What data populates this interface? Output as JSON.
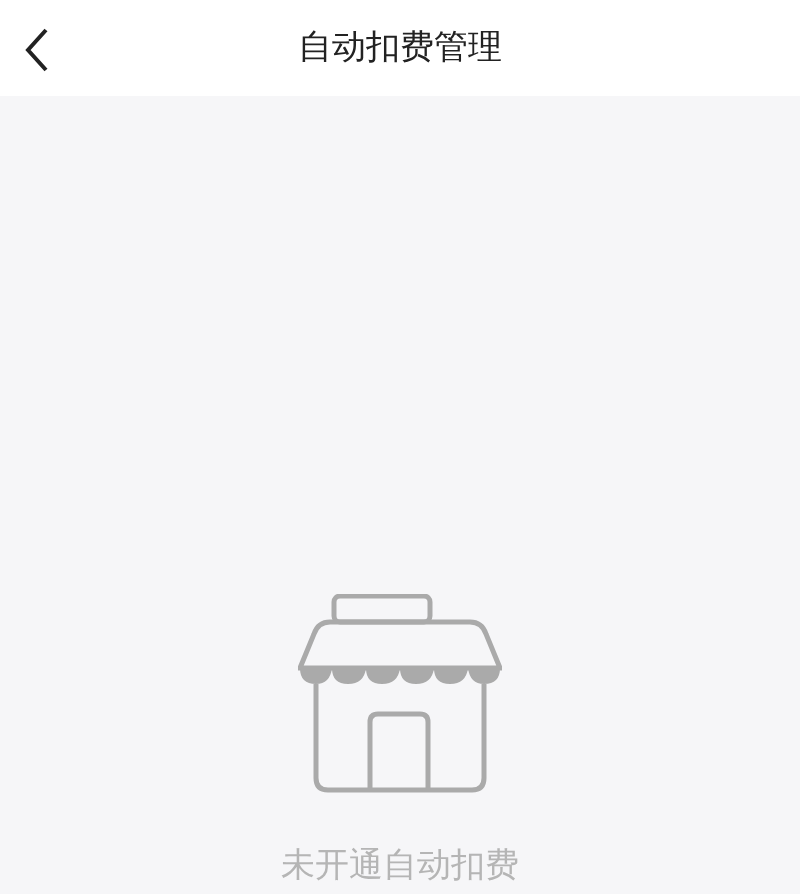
{
  "header": {
    "title": "自动扣费管理"
  },
  "empty_state": {
    "message": "未开通自动扣费"
  }
}
